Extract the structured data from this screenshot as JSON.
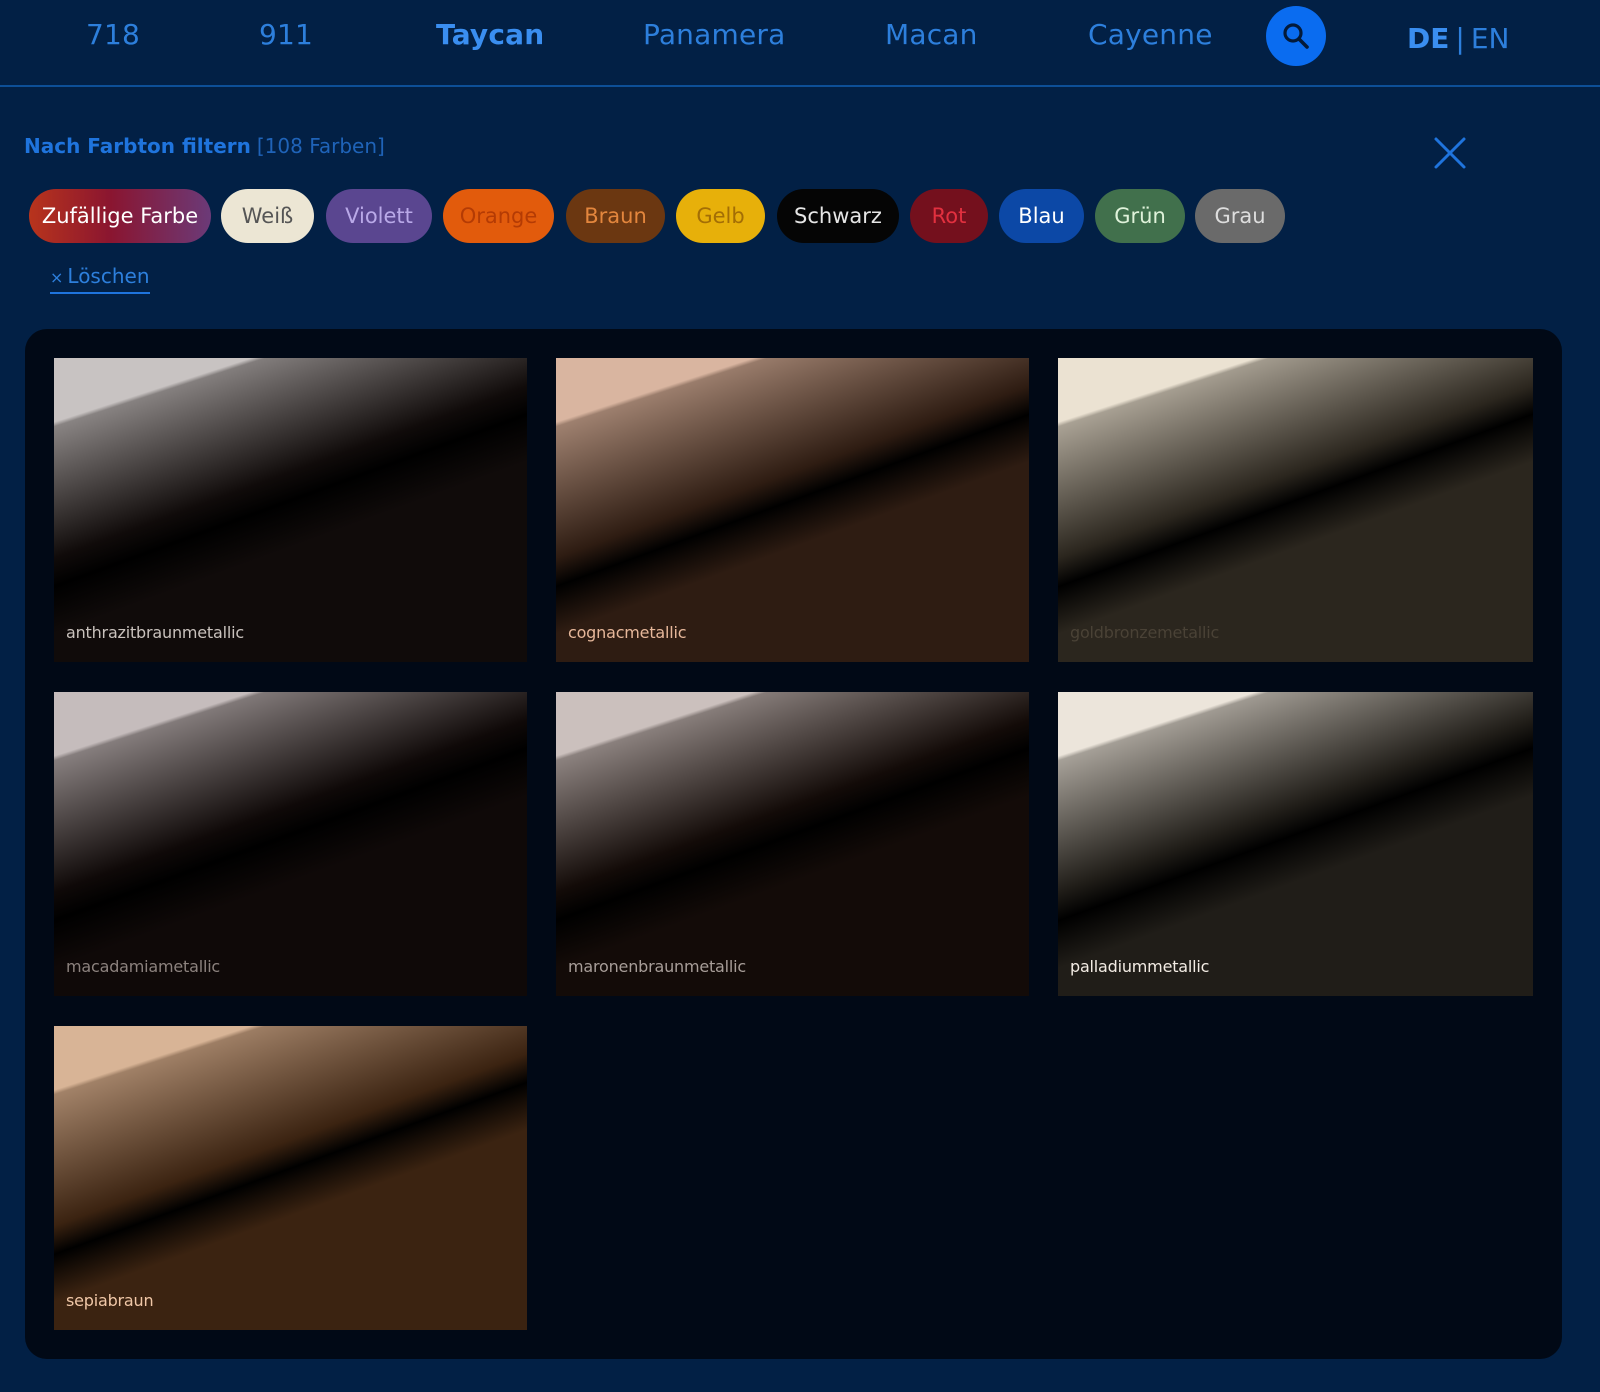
{
  "nav": {
    "items": [
      {
        "label": "718"
      },
      {
        "label": "911"
      },
      {
        "label": "Taycan",
        "active": true
      },
      {
        "label": "Panamera"
      },
      {
        "label": "Macan"
      },
      {
        "label": "Cayenne"
      }
    ],
    "search_icon": "search-icon",
    "lang": {
      "de": "DE",
      "separator": "|",
      "en": "EN",
      "active": "DE"
    }
  },
  "filter": {
    "label": "Nach Farbton filtern",
    "count": "[108 Farben]",
    "close_icon": "close-icon",
    "chips": [
      {
        "label": "Zufällige Farbe",
        "bg": "gradient",
        "text": "#ffffff"
      },
      {
        "label": "Weiß",
        "bg": "#ece6d4",
        "text": "#555555"
      },
      {
        "label": "Violett",
        "bg": "#5a4690",
        "text": "#b9a9e8"
      },
      {
        "label": "Orange",
        "bg": "#e25b0c",
        "text": "#b43b04"
      },
      {
        "label": "Braun",
        "bg": "#6b3711",
        "text": "#e3863d"
      },
      {
        "label": "Gelb",
        "bg": "#e7b00a",
        "text": "#a36e05"
      },
      {
        "label": "Schwarz",
        "bg": "#050505",
        "text": "#e6e6e6"
      },
      {
        "label": "Rot",
        "bg": "#74101d",
        "text": "#e2303f"
      },
      {
        "label": "Blau",
        "bg": "#0c48a6",
        "text": "#ffffff"
      },
      {
        "label": "Grün",
        "bg": "#41704c",
        "text": "#dff2da"
      },
      {
        "label": "Grau",
        "bg": "#6a6a6a",
        "text": "#dddddd"
      }
    ],
    "clear": {
      "label": "Löschen",
      "icon": "×"
    }
  },
  "swatches": [
    {
      "name": "anthrazitbraunmetallic",
      "label_color": "#c9c2bd",
      "light": "#c8c3c2",
      "dark": "#100b0a"
    },
    {
      "name": "cognacmetallic",
      "label_color": "#e6b79a",
      "light": "#d9b5a0",
      "dark": "#2e1c12"
    },
    {
      "name": "goldbronzemetallic",
      "label_color": "#4a4236",
      "light": "#ebe2d2",
      "dark": "#2b261e"
    },
    {
      "name": "macadamiametallic",
      "label_color": "#8c827e",
      "light": "#c5bcbc",
      "dark": "#0f0908"
    },
    {
      "name": "maronenbraunmetallic",
      "label_color": "#a79d98",
      "light": "#cbc0bd",
      "dark": "#130b08"
    },
    {
      "name": "palladiummetallic",
      "label_color": "#f3ece4",
      "light": "#ece5db",
      "dark": "#201d18"
    },
    {
      "name": "sepiabraun",
      "label_color": "#f0c7a7",
      "light": "#d8b496",
      "dark": "#3b2311"
    }
  ]
}
